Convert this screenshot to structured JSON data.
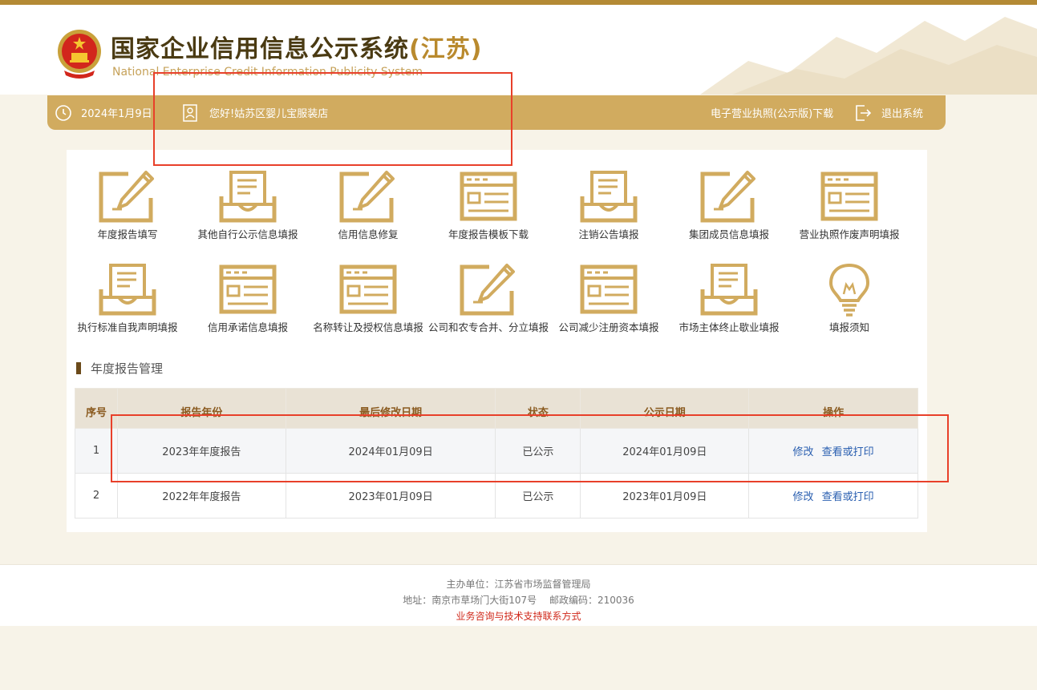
{
  "header": {
    "title_main": "国家企业信用信息公示系统",
    "title_province": "(江苏)",
    "subtitle": "National Enterprise Credit Information Publicity System",
    "emblem_icon": "national-emblem-icon"
  },
  "navbar": {
    "date": "2024年1月9日",
    "greeting": "您好!姑苏区婴儿宝服装店",
    "license_download": "电子营业执照(公示版)下载",
    "logout": "退出系统",
    "clock_icon": "clock-icon",
    "user_icon": "user-card-icon",
    "logout_icon": "logout-icon"
  },
  "tiles": [
    {
      "label": "年度报告填写",
      "icon": "pencil-doc-icon"
    },
    {
      "label": "其他自行公示信息填报",
      "icon": "inbox-doc-icon"
    },
    {
      "label": "信用信息修复",
      "icon": "pencil-doc-icon"
    },
    {
      "label": "年度报告模板下载",
      "icon": "form-window-icon"
    },
    {
      "label": "注销公告填报",
      "icon": "inbox-doc-icon"
    },
    {
      "label": "集团成员信息填报",
      "icon": "pencil-doc-icon"
    },
    {
      "label": "营业执照作废声明填报",
      "icon": "form-window-icon"
    },
    {
      "label": "执行标准自我声明填报",
      "icon": "inbox-doc-icon"
    },
    {
      "label": "信用承诺信息填报",
      "icon": "form-window-icon"
    },
    {
      "label": "名称转让及授权信息填报",
      "icon": "form-window-icon"
    },
    {
      "label": "公司和农专合并、分立填报",
      "icon": "pencil-doc-icon"
    },
    {
      "label": "公司减少注册资本填报",
      "icon": "form-window-icon"
    },
    {
      "label": "市场主体终止歇业填报",
      "icon": "inbox-doc-icon"
    },
    {
      "label": "填报须知",
      "icon": "lightbulb-icon"
    }
  ],
  "report_section": {
    "title": "年度报告管理",
    "columns": [
      "序号",
      "报告年份",
      "最后修改日期",
      "状态",
      "公示日期",
      "操作"
    ],
    "rows": [
      {
        "index": "1",
        "year": "2023年年度报告",
        "modified": "2024年01月09日",
        "status": "已公示",
        "published": "2024年01月09日",
        "edit": "修改",
        "view": "查看或打印"
      },
      {
        "index": "2",
        "year": "2022年年度报告",
        "modified": "2023年01月09日",
        "status": "已公示",
        "published": "2023年01月09日",
        "edit": "修改",
        "view": "查看或打印"
      }
    ]
  },
  "footer": {
    "organizer": "主办单位：江苏省市场监督管理局",
    "address": "地址：南京市草场门大街107号　 邮政编码：210036",
    "support": "业务咨询与技术支持联系方式"
  },
  "colors": {
    "gold": "#d1ab5f",
    "dark_gold": "#b48a35",
    "highlight": "#e8402a",
    "link": "#2a5fb0"
  }
}
